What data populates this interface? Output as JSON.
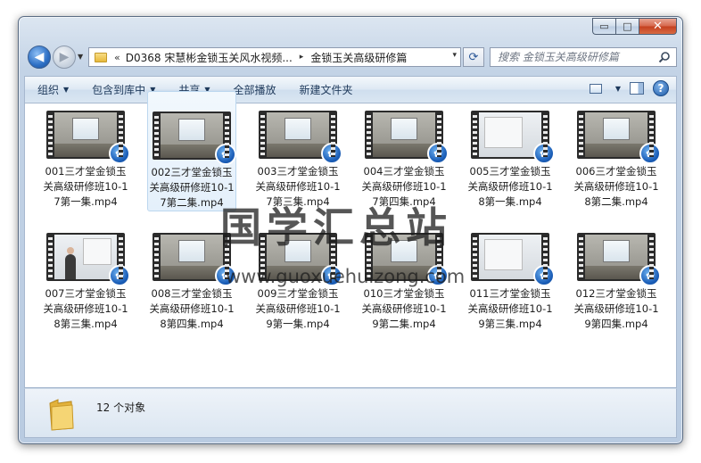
{
  "window": {
    "caption_buttons": {
      "minimize": "▭",
      "maximize": "□",
      "close": "✕"
    }
  },
  "nav": {
    "back_glyph": "◀",
    "forward_glyph": "▶",
    "recent_glyph": "▼",
    "refresh_glyph": "⟳",
    "address": {
      "chevron": "«",
      "segments": [
        "D0368 宋慧彬金锁玉关风水视频...",
        "金锁玉关高级研修篇"
      ],
      "separator": "▸",
      "dropdown": "▾"
    },
    "search": {
      "placeholder": "搜索 金锁玉关高级研修篇"
    }
  },
  "commands": {
    "organize": "组织",
    "include_library": "包含到库中",
    "share": "共享",
    "play_all": "全部播放",
    "new_folder": "新建文件夹",
    "dropdown_arrow": "▼",
    "help": "?"
  },
  "files": [
    {
      "name": "001三才堂金锁玉关高级研修班10-17第一集.mp4",
      "thumb": "class"
    },
    {
      "name": "002三才堂金锁玉关高级研修班10-17第二集.mp4",
      "thumb": "class"
    },
    {
      "name": "003三才堂金锁玉关高级研修班10-17第三集.mp4",
      "thumb": "class"
    },
    {
      "name": "004三才堂金锁玉关高级研修班10-17第四集.mp4",
      "thumb": "class"
    },
    {
      "name": "005三才堂金锁玉关高级研修班10-18第一集.mp4",
      "thumb": "light"
    },
    {
      "name": "006三才堂金锁玉关高级研修班10-18第二集.mp4",
      "thumb": "class"
    },
    {
      "name": "007三才堂金锁玉关高级研修班10-18第三集.mp4",
      "thumb": "person"
    },
    {
      "name": "008三才堂金锁玉关高级研修班10-18第四集.mp4",
      "thumb": "class"
    },
    {
      "name": "009三才堂金锁玉关高级研修班10-19第一集.mp4",
      "thumb": "class"
    },
    {
      "name": "010三才堂金锁玉关高级研修班10-19第二集.mp4",
      "thumb": "class"
    },
    {
      "name": "011三才堂金锁玉关高级研修班10-19第三集.mp4",
      "thumb": "light"
    },
    {
      "name": "012三才堂金锁玉关高级研修班10-19第四集.mp4",
      "thumb": "class"
    }
  ],
  "media_badge_glyph": "✿",
  "watermark": {
    "cn": "国学汇总站",
    "url": "www.guoxuehuizong.com"
  },
  "details": {
    "count": "12 个对象"
  }
}
